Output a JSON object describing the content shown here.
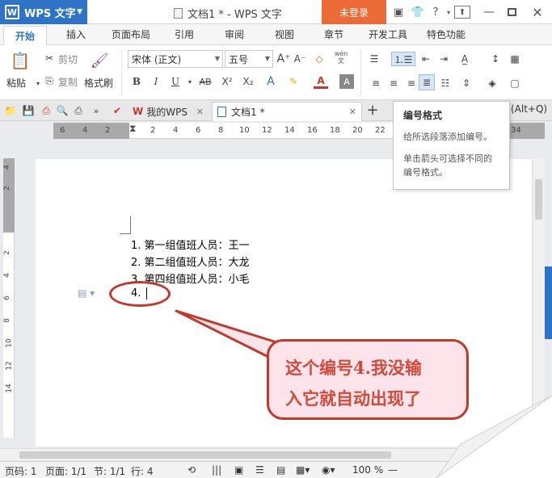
{
  "app": {
    "name": "WPS 文字",
    "document_title": "文档1 * - WPS 文字",
    "login_label": "未登录"
  },
  "menu": {
    "tabs": [
      "开始",
      "插入",
      "页面布局",
      "引用",
      "审阅",
      "视图",
      "章节",
      "开发工具",
      "特色功能"
    ]
  },
  "ribbon": {
    "paste": "粘贴",
    "cut": "剪切",
    "copy": "复制",
    "format_painter": "格式刷",
    "font_name": "宋体 (正文)",
    "font_size": "五号",
    "wen": "wén\n文"
  },
  "tabs": {
    "wps_tab": "我的WPS",
    "doc_tab": "文档1 *"
  },
  "tooltip": {
    "title": "编号格式",
    "line1": "给所选段落添加编号。",
    "line2": "单击箭头可选择不同的",
    "line3": "编号格式。",
    "shortcut": "(Alt+Q)"
  },
  "ruler": {
    "numbers": [
      "6",
      "4",
      "2",
      "2",
      "4",
      "6",
      "8",
      "10",
      "12",
      "14",
      "16",
      "18",
      "20",
      "22",
      "24",
      "26",
      "34"
    ]
  },
  "vruler": {
    "numbers": [
      "4",
      "2",
      "2",
      "4",
      "6",
      "8",
      "10",
      "12",
      "14"
    ]
  },
  "document": {
    "items": [
      "1. 第一组值班人员：王一",
      "2. 第二组值班人员：大龙",
      "3. 第四组值班人员：小毛",
      "4."
    ]
  },
  "annotation": {
    "line1": "这个编号4.我没输",
    "line2": "入它就自动出现了"
  },
  "status": {
    "page": "页码: 1",
    "pages": "页面: 1/1",
    "section": "节: 1/1",
    "row": "行: 4",
    "zoom": "100 %"
  },
  "colors": {
    "accent_blue": "#2f73c6",
    "login_orange": "#ec6a36",
    "annotation_red": "#c0392b"
  }
}
